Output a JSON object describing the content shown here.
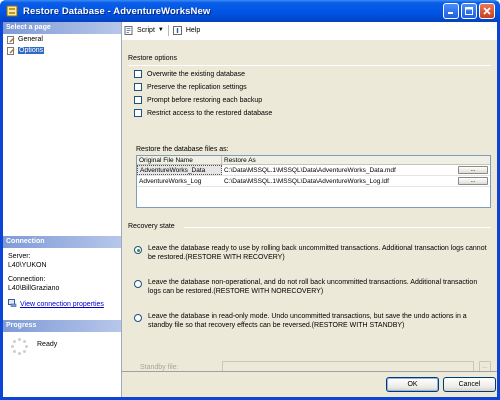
{
  "window": {
    "title": "Restore Database - AdventureWorksNew",
    "controls": [
      "minimize",
      "maximize",
      "close"
    ]
  },
  "sidebar": {
    "select_page_header": "Select a page",
    "pages": [
      {
        "label": "General",
        "icon": "page-wrench-icon",
        "selected": false
      },
      {
        "label": "Options",
        "icon": "page-wrench-icon",
        "selected": true
      }
    ],
    "connection_header": "Connection",
    "server_label": "Server:",
    "server_value": "L40\\YUKON",
    "connection_label": "Connection:",
    "connection_value": "L40\\BillGraziano",
    "view_connection_link": "View connection properties",
    "progress_header": "Progress",
    "progress_status": "Ready"
  },
  "toolbar": {
    "script_label": "Script",
    "help_label": "Help"
  },
  "restore_options": {
    "title": "Restore options",
    "checkboxes": [
      {
        "label": "Overwrite the existing database",
        "checked": false
      },
      {
        "label": "Preserve the replication settings",
        "checked": false
      },
      {
        "label": "Prompt before restoring each backup",
        "checked": false
      },
      {
        "label": "Restrict access to the restored database",
        "checked": false
      }
    ],
    "files_label": "Restore the database files as:",
    "files_columns": [
      "Original File Name",
      "Restore As"
    ],
    "files_rows": [
      {
        "original": "AdventureWorks_Data",
        "restore_as": "C:\\Data\\MSSQL.1\\MSSQL\\Data\\AdventureWorks_Data.mdf",
        "button": "..."
      },
      {
        "original": "AdventureWorks_Log",
        "restore_as": "C:\\Data\\MSSQL.1\\MSSQL\\Data\\AdventureWorks_Log.ldf",
        "button": "..."
      }
    ]
  },
  "recovery_state": {
    "title": "Recovery state",
    "options": [
      {
        "text": "Leave the database ready to use by rolling back uncommitted transactions. Additional transaction logs cannot be restored.(RESTORE WITH RECOVERY)",
        "checked": true
      },
      {
        "text": "Leave the database non-operational, and do not roll back uncommitted transactions. Additional transaction logs can be restored.(RESTORE WITH NORECOVERY)",
        "checked": false
      },
      {
        "text": "Leave the database in read-only mode. Undo uncommitted transactions, but save the undo actions in a standby file so that recovery effects can be reversed.(RESTORE WITH STANDBY)",
        "checked": false
      }
    ],
    "standby_label": "Standby file:",
    "standby_value": "",
    "standby_button": "..."
  },
  "footer": {
    "ok_label": "OK",
    "cancel_label": "Cancel"
  },
  "colors": {
    "titlebar": "#0055e5",
    "selection": "#316ac5",
    "link": "#0000cc",
    "dialog_bg": "#ece9d8"
  }
}
